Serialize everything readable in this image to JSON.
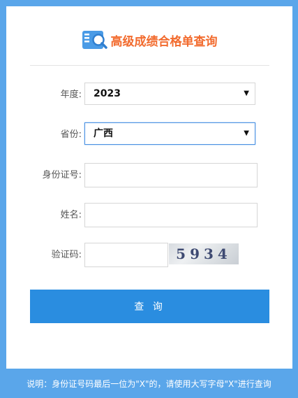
{
  "header": {
    "title": "高级成绩合格单查询",
    "icon": "search-document-icon"
  },
  "form": {
    "year": {
      "label": "年度:",
      "value": "2023"
    },
    "province": {
      "label": "省份:",
      "value": "广西"
    },
    "id_number": {
      "label": "身份证号:",
      "value": ""
    },
    "name": {
      "label": "姓名:",
      "value": ""
    },
    "captcha": {
      "label": "验证码:",
      "value": "",
      "image_text": "5934"
    },
    "submit_label": "查 询"
  },
  "footer": {
    "note": "说明：身份证号码最后一位为\"X\"的，请使用大写字母\"X\"进行查询"
  },
  "colors": {
    "background": "#5aa6ea",
    "accent": "#2a8de0",
    "title": "#f26b2e"
  }
}
